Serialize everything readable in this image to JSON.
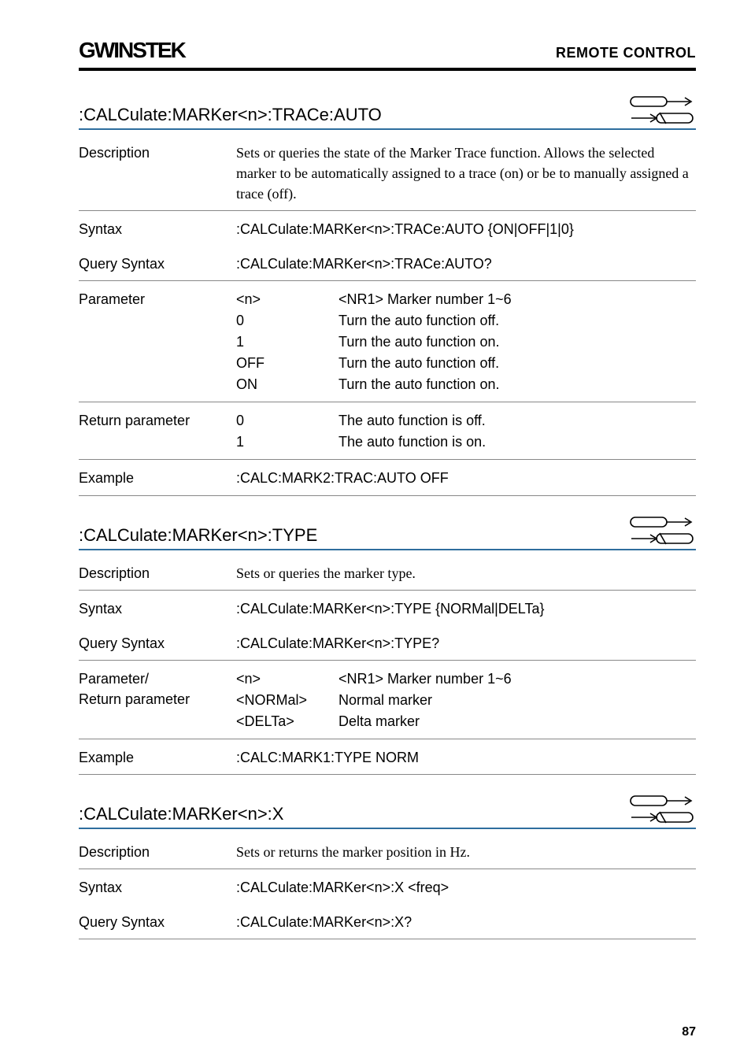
{
  "header": {
    "logo": "GWINSTEK",
    "section": "REMOTE CONTROL"
  },
  "blocks": [
    {
      "title": ":CALCulate:MARKer<n>:TRACe:AUTO",
      "set_icon": true,
      "query_icon": true,
      "rows": [
        {
          "label": "Description",
          "labelSerif": true,
          "contentSerif": true,
          "text": "Sets or queries the state of the Marker Trace function. Allows the selected marker to be automatically assigned to a trace (on) or be to manually assigned a trace (off)."
        },
        {
          "label": "Syntax",
          "text": ":CALCulate:MARKer<n>:TRACe:AUTO {ON|OFF|1|0}",
          "noborder": true
        },
        {
          "label": "Query Syntax",
          "text": ":CALCulate:MARKer<n>:TRACe:AUTO?"
        },
        {
          "label": "Parameter",
          "params": [
            {
              "k": "<n>",
              "v": "<NR1> Marker number 1~6"
            },
            {
              "k": "0",
              "v": "Turn the auto function off."
            },
            {
              "k": "1",
              "v": "Turn the auto function on."
            },
            {
              "k": "OFF",
              "v": "Turn the auto function off."
            },
            {
              "k": "ON",
              "v": "Turn the auto function on."
            }
          ]
        },
        {
          "label": "Return parameter",
          "params": [
            {
              "k": "0",
              "v": "The auto function is off."
            },
            {
              "k": "1",
              "v": "The auto function is on."
            }
          ]
        },
        {
          "label": "Example",
          "text": ":CALC:MARK2:TRAC:AUTO OFF"
        }
      ]
    },
    {
      "title": ":CALCulate:MARKer<n>:TYPE",
      "set_icon": true,
      "query_icon": true,
      "rows": [
        {
          "label": "Description",
          "labelSerif": true,
          "contentSerif": true,
          "text": "Sets or queries the marker type."
        },
        {
          "label": "Syntax",
          "text": ":CALCulate:MARKer<n>:TYPE {NORMal|DELTa}",
          "noborder": true
        },
        {
          "label": "Query Syntax",
          "text": ":CALCulate:MARKer<n>:TYPE?"
        },
        {
          "label": "Parameter/\nReturn parameter",
          "params": [
            {
              "k": "<n>",
              "v": "<NR1> Marker number 1~6"
            },
            {
              "k": "<NORMal>",
              "v": "Normal marker"
            },
            {
              "k": "<DELTa>",
              "v": "Delta marker"
            }
          ]
        },
        {
          "label": "Example",
          "text": ":CALC:MARK1:TYPE NORM"
        }
      ]
    },
    {
      "title": ":CALCulate:MARKer<n>:X",
      "set_icon": true,
      "query_icon": true,
      "rows": [
        {
          "label": "Description",
          "labelSerif": true,
          "contentSerif": true,
          "text": "Sets or returns the marker position in Hz."
        },
        {
          "label": "Syntax",
          "text": ":CALCulate:MARKer<n>:X <freq>",
          "noborder": true
        },
        {
          "label": "Query Syntax",
          "text": ":CALCulate:MARKer<n>:X?"
        }
      ]
    }
  ],
  "page": "87"
}
